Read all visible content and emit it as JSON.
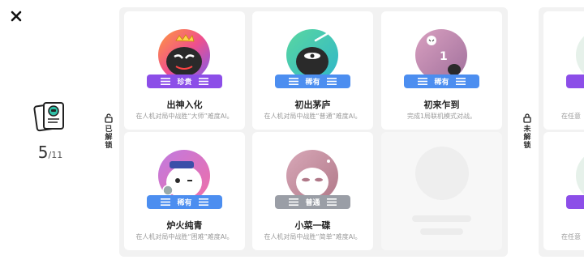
{
  "progress": {
    "unlocked": "5",
    "total": "/11"
  },
  "sections": {
    "unlocked_label": "已解锁",
    "locked_label": "未解锁"
  },
  "achievements": [
    {
      "title": "出神入化",
      "rarity": "珍贵",
      "rarity_color": "#8c4ee8",
      "description": "在人机对局中战胜“大师”难度AI。"
    },
    {
      "title": "初出茅庐",
      "rarity": "稀有",
      "rarity_color": "#4c8ef0",
      "description": "在人机对局中战胜“普通”难度AI。"
    },
    {
      "title": "初来乍到",
      "rarity": "稀有",
      "rarity_color": "#4c8ef0",
      "description": "完成1局联机模式对战。"
    },
    {
      "title": "炉火纯青",
      "rarity": "稀有",
      "rarity_color": "#4c8ef0",
      "description": "在人机对局中战胜“困难”难度AI。"
    },
    {
      "title": "小菜一碟",
      "rarity": "普通",
      "rarity_color": "#9a9ea6",
      "description": "在人机对局中战胜“简单”难度AI。"
    }
  ],
  "locked_edge": {
    "description_prefix": "在任意"
  },
  "icons": {
    "close": "close-icon",
    "collection": "cards-collection-icon",
    "lock_open": "unlock-icon",
    "lock_closed": "lock-icon"
  }
}
